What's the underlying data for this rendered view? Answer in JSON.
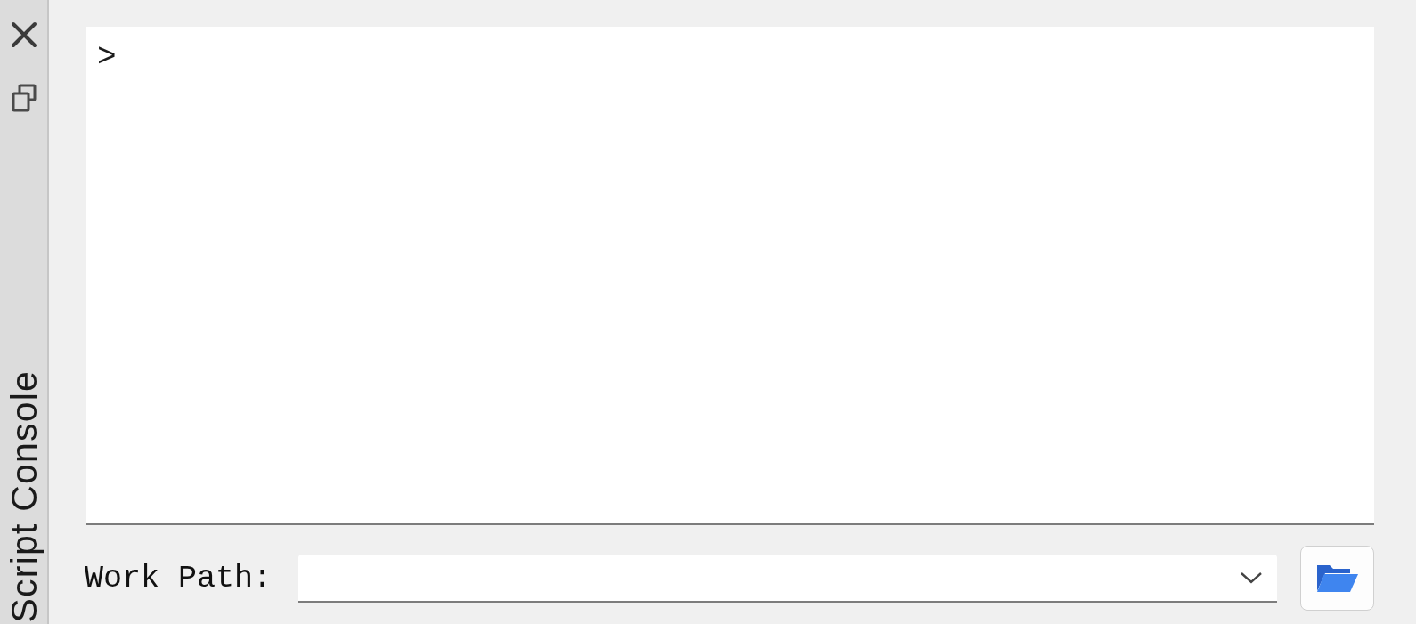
{
  "sidebar": {
    "title": "Script Console"
  },
  "console": {
    "prompt": ">"
  },
  "work_path": {
    "label": "Work Path:"
  }
}
